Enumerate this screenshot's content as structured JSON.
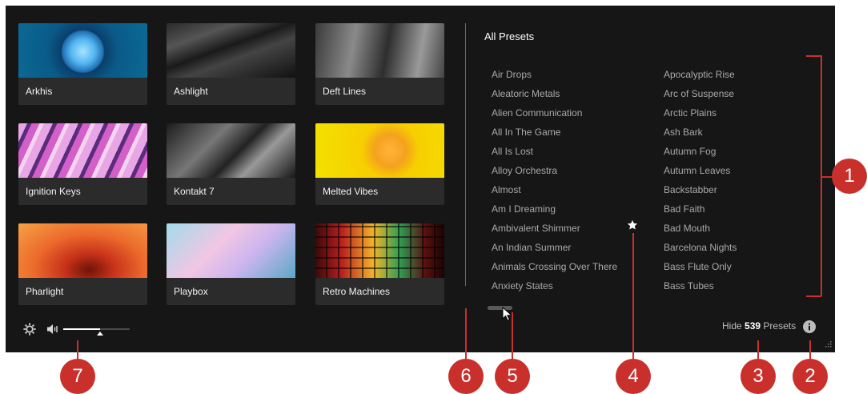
{
  "libraries": [
    {
      "name": "Arkhis"
    },
    {
      "name": "Ashlight"
    },
    {
      "name": "Deft Lines"
    },
    {
      "name": "Ignition Keys"
    },
    {
      "name": "Kontakt 7"
    },
    {
      "name": "Melted Vibes"
    },
    {
      "name": "Pharlight"
    },
    {
      "name": "Playbox"
    },
    {
      "name": "Retro Machines"
    }
  ],
  "volume": {
    "level": 0.55
  },
  "presets": {
    "title": "All Presets",
    "left_column": [
      "Air Drops",
      "Aleatoric Metals",
      "Alien Communication",
      "All In The Game",
      "All Is Lost",
      "Alloy Orchestra",
      "Almost",
      "Am I Dreaming",
      "Ambivalent Shimmer",
      "An Indian Summer",
      "Animals Crossing Over There",
      "Anxiety States"
    ],
    "right_column": [
      "Apocalyptic Rise",
      "Arc of Suspense",
      "Arctic Plains",
      "Ash Bark",
      "Autumn Fog",
      "Autumn Leaves",
      "Backstabber",
      "Bad Faith",
      "Bad Mouth",
      "Barcelona Nights",
      "Bass Flute Only",
      "Bass Tubes"
    ],
    "favorite_icon": "star-icon"
  },
  "footer": {
    "hide_prefix": "Hide",
    "preset_count": "539",
    "hide_suffix": "Presets"
  },
  "callouts": [
    "1",
    "2",
    "3",
    "4",
    "5",
    "6",
    "7"
  ],
  "colors": {
    "panel": "#161616",
    "tile": "#2b2b2b",
    "callout": "#c9302c",
    "preset_text": "#a9a9a9"
  }
}
